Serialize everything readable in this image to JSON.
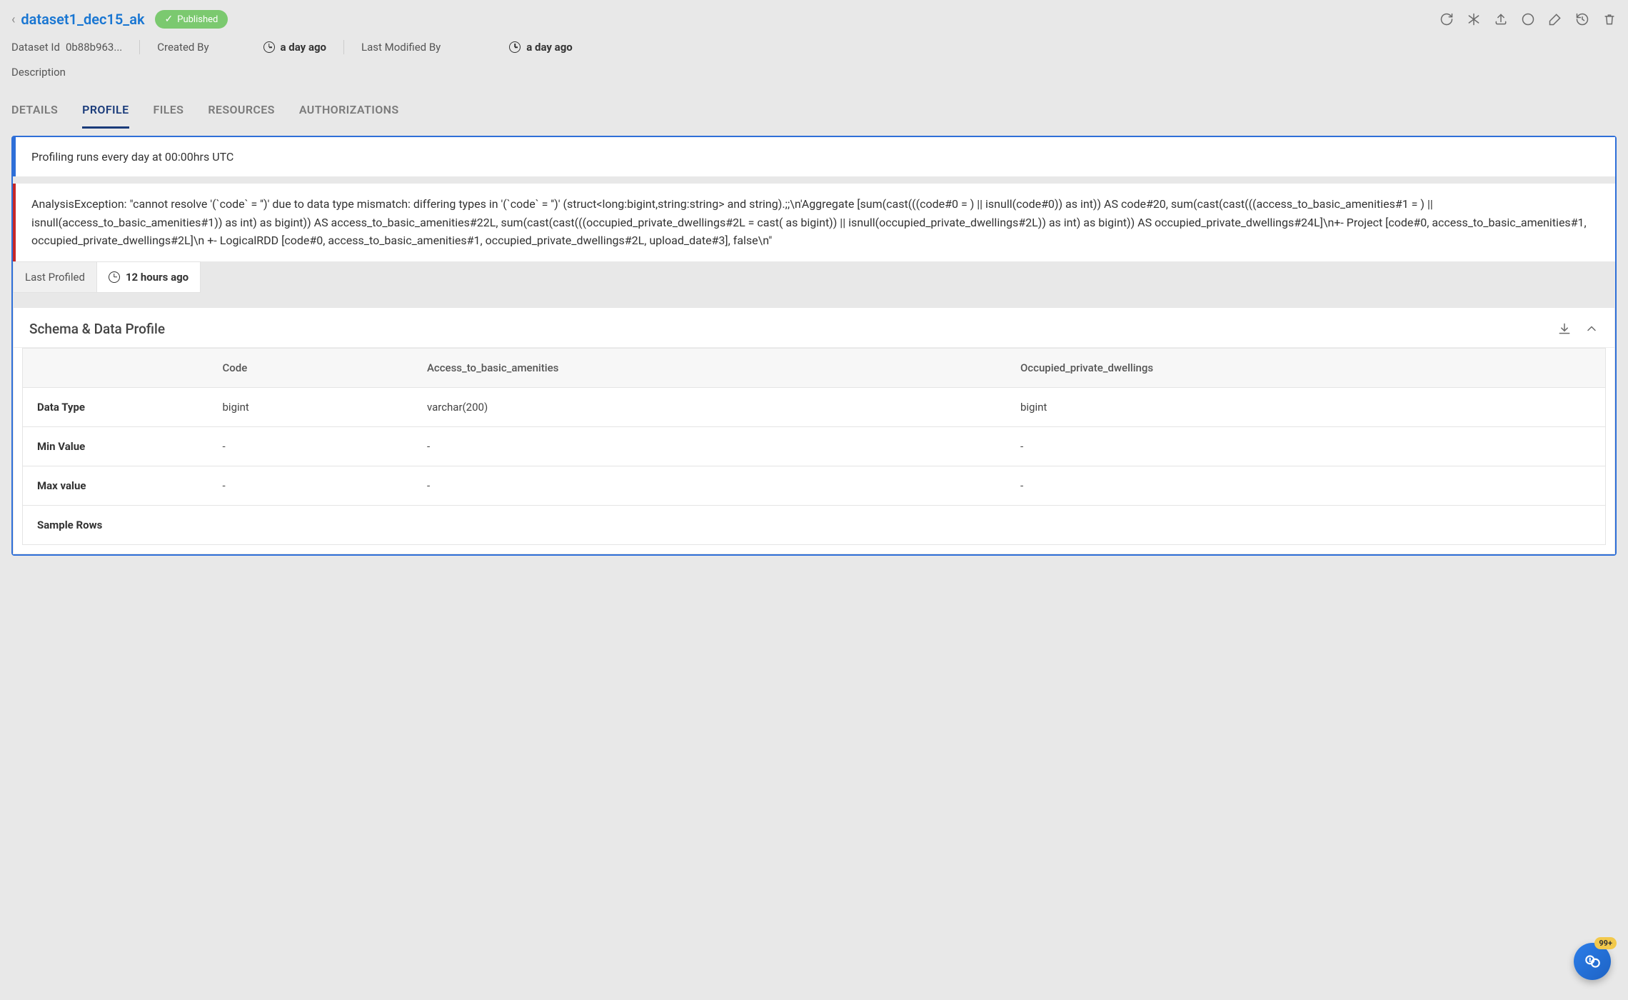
{
  "header": {
    "title": "dataset1_dec15_ak",
    "status_label": "Published"
  },
  "meta": {
    "dataset_id_label": "Dataset Id",
    "dataset_id_value": "0b88b963...",
    "created_by_label": "Created By",
    "created_by_value": "",
    "created_ago": "a day ago",
    "last_modified_by_label": "Last Modified By",
    "last_modified_by_value": "",
    "last_modified_ago": "a day ago",
    "description_label": "Description"
  },
  "tabs": {
    "details": "DETAILS",
    "profile": "PROFILE",
    "files": "FILES",
    "resources": "RESOURCES",
    "authorizations": "AUTHORIZATIONS"
  },
  "profile": {
    "schedule_notice": "Profiling runs every day at 00:00hrs UTC",
    "error_text": "AnalysisException: \"cannot resolve '(`code` = '')' due to data type mismatch: differing types in '(`code` = '')' (struct<long:bigint,string:string> and string).;;\\n'Aggregate [sum(cast(((code#0 = ) || isnull(code#0)) as int)) AS code#20, sum(cast(cast(((access_to_basic_amenities#1 = ) || isnull(access_to_basic_amenities#1)) as int) as bigint)) AS access_to_basic_amenities#22L, sum(cast(cast(((occupied_private_dwellings#2L = cast( as bigint)) || isnull(occupied_private_dwellings#2L)) as int) as bigint)) AS occupied_private_dwellings#24L]\\n+- Project [code#0, access_to_basic_amenities#1, occupied_private_dwellings#2L]\\n +- LogicalRDD [code#0, access_to_basic_amenities#1, occupied_private_dwellings#2L, upload_date#3], false\\n\"",
    "last_profiled_label": "Last Profiled",
    "last_profiled_value": "12 hours ago"
  },
  "schema": {
    "title": "Schema & Data Profile",
    "columns": [
      "",
      "Code",
      "Access_to_basic_amenities",
      "Occupied_private_dwellings"
    ],
    "rows": [
      {
        "label": "Data Type",
        "values": [
          "bigint",
          "varchar(200)",
          "bigint"
        ]
      },
      {
        "label": "Min Value",
        "values": [
          "-",
          "-",
          "-"
        ]
      },
      {
        "label": "Max value",
        "values": [
          "-",
          "-",
          "-"
        ]
      },
      {
        "label": "Sample Rows",
        "values": [
          "",
          "",
          ""
        ]
      }
    ]
  },
  "help_badge": "99+"
}
